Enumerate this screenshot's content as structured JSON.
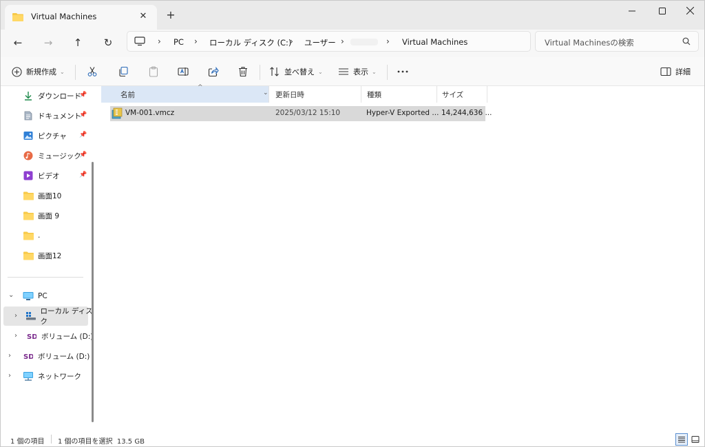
{
  "window": {
    "tab_title": "Virtual Machines",
    "tab_close_icon": "close-icon",
    "new_tab_icon": "plus-icon",
    "controls": [
      "minimize-icon",
      "maximize-icon",
      "close-icon"
    ]
  },
  "nav": {
    "back_icon": "arrow-left-icon",
    "forward_icon": "arrow-right-icon",
    "up_icon": "arrow-up-icon",
    "refresh_icon": "refresh-icon"
  },
  "address": {
    "crumbs": [
      "PC",
      "ローカル ディスク (C:)",
      "ユーザー",
      "Virtual Machines"
    ],
    "search_placeholder": "Virtual Machinesの検索"
  },
  "toolbar": {
    "new_label": "新規作成",
    "sort_label": "並べ替え",
    "view_label": "表示",
    "details_label": "詳細"
  },
  "sidebar": {
    "quick_access": [
      {
        "label": "ダウンロード",
        "icon": "download-icon",
        "pinned": true
      },
      {
        "label": "ドキュメント",
        "icon": "document-icon",
        "pinned": true
      },
      {
        "label": "ピクチャ",
        "icon": "picture-icon",
        "pinned": true
      },
      {
        "label": "ミュージック",
        "icon": "music-icon",
        "pinned": true
      },
      {
        "label": "ビデオ",
        "icon": "video-icon",
        "pinned": true
      },
      {
        "label": "画面10",
        "icon": "folder-icon",
        "pinned": false
      },
      {
        "label": "画面 9",
        "icon": "folder-icon",
        "pinned": false
      },
      {
        "label": ".",
        "icon": "folder-icon",
        "pinned": false
      },
      {
        "label": "画面12",
        "icon": "folder-icon",
        "pinned": false
      }
    ],
    "pc_label": "PC",
    "local_disk_label": "ローカル ディスク",
    "volume_d_label": "ボリューム (D:)",
    "volume_d2_label": "ボリューム (D:)",
    "network_label": "ネットワーク"
  },
  "columns": {
    "name": "名前",
    "date": "更新日時",
    "type": "種類",
    "size": "サイズ"
  },
  "files": [
    {
      "name": "VM-001.vmcz",
      "date": "2025/03/12 15:10",
      "type": "Hyper-V Exported ...",
      "size": "14,244,636 ..."
    }
  ],
  "status": {
    "count": "1 個の項目",
    "selected": "1 個の項目を選択  13.5 GB"
  },
  "colors": {
    "accent": "#0067c0",
    "folder": "#f7c948",
    "selection": "#d9d9d9",
    "header_highlight": "#dbe7f6"
  }
}
